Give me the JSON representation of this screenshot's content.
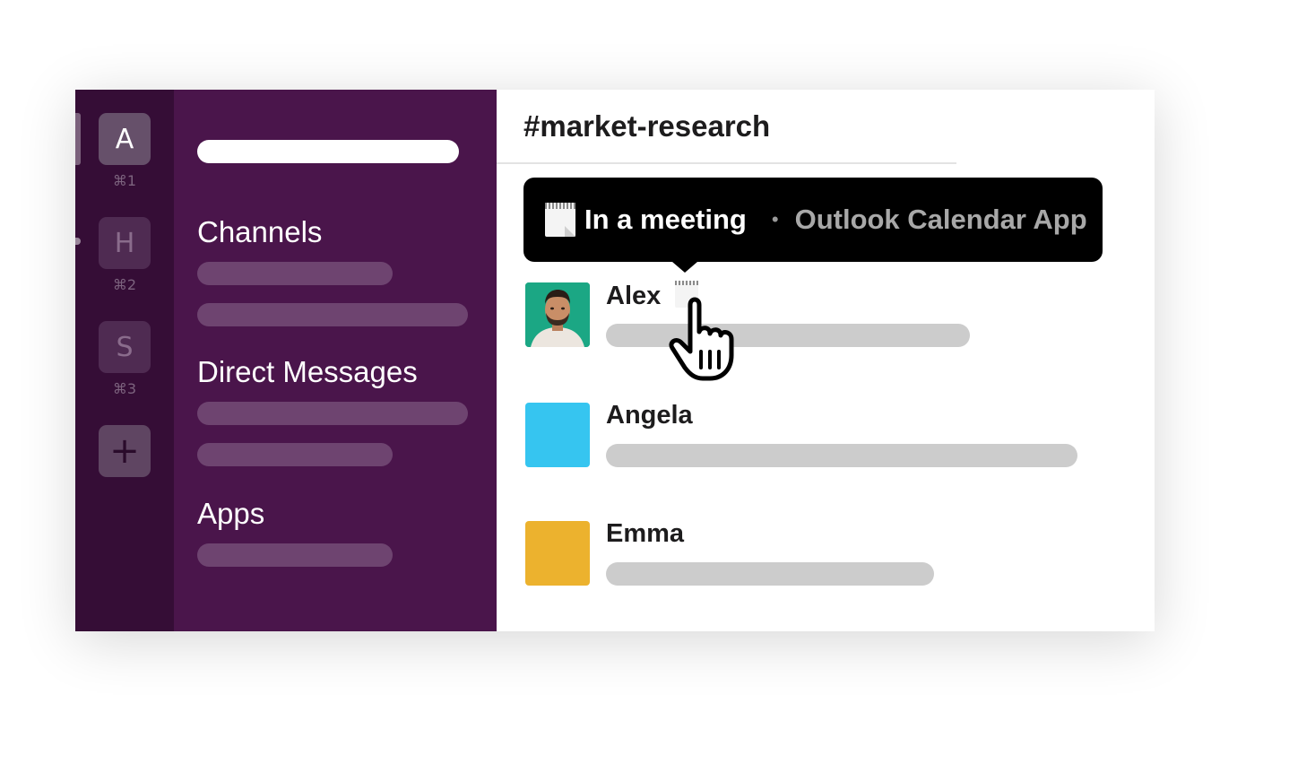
{
  "workspaces": [
    {
      "letter": "A",
      "shortcut": "⌘1",
      "active": true
    },
    {
      "letter": "H",
      "shortcut": "⌘2",
      "active": false
    },
    {
      "letter": "S",
      "shortcut": "⌘3",
      "active": false
    }
  ],
  "add_workspace_symbol": "+",
  "sidebar": {
    "channels_title": "Channels",
    "dms_title": "Direct Messages",
    "apps_title": "Apps"
  },
  "channel": {
    "name": "#market-research"
  },
  "tooltip": {
    "status_text": "In a meeting",
    "separator": "•",
    "app_name": "Outlook Calendar App",
    "icon": "spiral-notepad-icon"
  },
  "messages": [
    {
      "author": "Alex",
      "avatar": "photo",
      "has_status_icon": true
    },
    {
      "author": "Angela",
      "avatar_color": "#36c5f0"
    },
    {
      "author": "Emma",
      "avatar_color": "#ecb22e"
    }
  ],
  "colors": {
    "rail": "#350d36",
    "sidebar": "#4a154b",
    "tooltip": "#000000",
    "avatar_alex_bg": "#1ba784"
  }
}
